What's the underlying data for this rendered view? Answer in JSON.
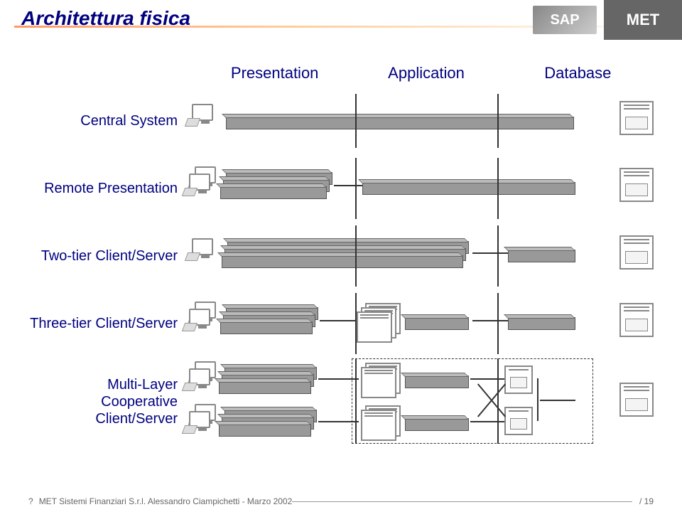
{
  "title": "Architettura fisica",
  "logos": {
    "sap": "SAP",
    "met": "MET"
  },
  "columns": {
    "presentation": "Presentation",
    "application": "Application",
    "database": "Database"
  },
  "rows": {
    "central": "Central System",
    "remote": "Remote Presentation",
    "two": "Two-tier Client/Server",
    "three": "Three-tier Client/Server",
    "multi": "Multi-Layer Cooperative Client/Server"
  },
  "footer": {
    "prefix": "?",
    "text": "MET Sistemi Finanziari S.r.l. Alessandro Ciampichetti - Marzo 2002",
    "page": "/ 19"
  },
  "chart_data": {
    "type": "table",
    "title": "Architettura fisica",
    "columns": [
      "Presentation",
      "Application",
      "Database"
    ],
    "rows": [
      {
        "name": "Central System",
        "presentation": "terminal",
        "application": "combined-bar",
        "database": "server"
      },
      {
        "name": "Remote Presentation",
        "presentation": "PC-stack + bar-stack",
        "application": "combined-bar",
        "database": "server"
      },
      {
        "name": "Two-tier Client/Server",
        "presentation": "PC + bar-stack",
        "application": "combined-bar",
        "database": "server"
      },
      {
        "name": "Three-tier Client/Server",
        "presentation": "PC-stack + bar-stack",
        "application": "app-server-stack + bar",
        "database": "server"
      },
      {
        "name": "Multi-Layer Cooperative Client/Server",
        "presentation": "2× PC-stack + bar-stack",
        "application": "2× app-server-stack + db pair",
        "database": "server"
      }
    ]
  }
}
